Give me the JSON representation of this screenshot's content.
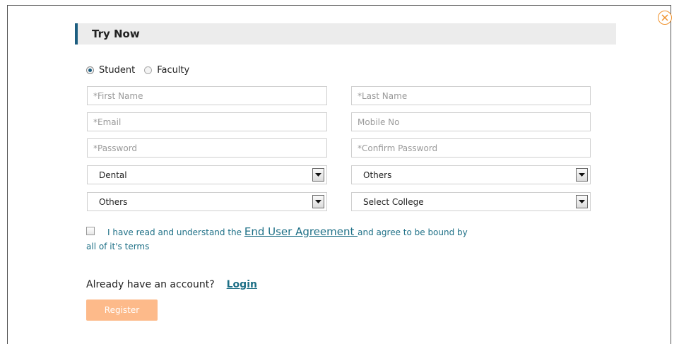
{
  "modal": {
    "title": "Try Now",
    "close_icon": "close-circle-icon",
    "accent_color": "#1d5e80",
    "close_color": "#f0922c"
  },
  "user_type": {
    "options": [
      {
        "label": "Student",
        "selected": true
      },
      {
        "label": "Faculty",
        "selected": false
      }
    ]
  },
  "form": {
    "first_name_placeholder": "*First Name",
    "last_name_placeholder": "*Last Name",
    "email_placeholder": "*Email",
    "mobile_placeholder": "Mobile No",
    "password_placeholder": "*Password",
    "confirm_password_placeholder": "*Confirm Password",
    "course_select": "Dental",
    "state_select": "Others",
    "university_select": "Others",
    "college_select": "Select College"
  },
  "agreement": {
    "text_before": "I have read and understand the ",
    "link_text": "End User Agreement ",
    "text_after": "and agree to be bound by",
    "text_line2": "all of it's terms",
    "checked": false
  },
  "account": {
    "prompt": "Already have an account?",
    "login_label": "Login"
  },
  "actions": {
    "register_label": "Register",
    "register_color": "#fdba8a"
  }
}
